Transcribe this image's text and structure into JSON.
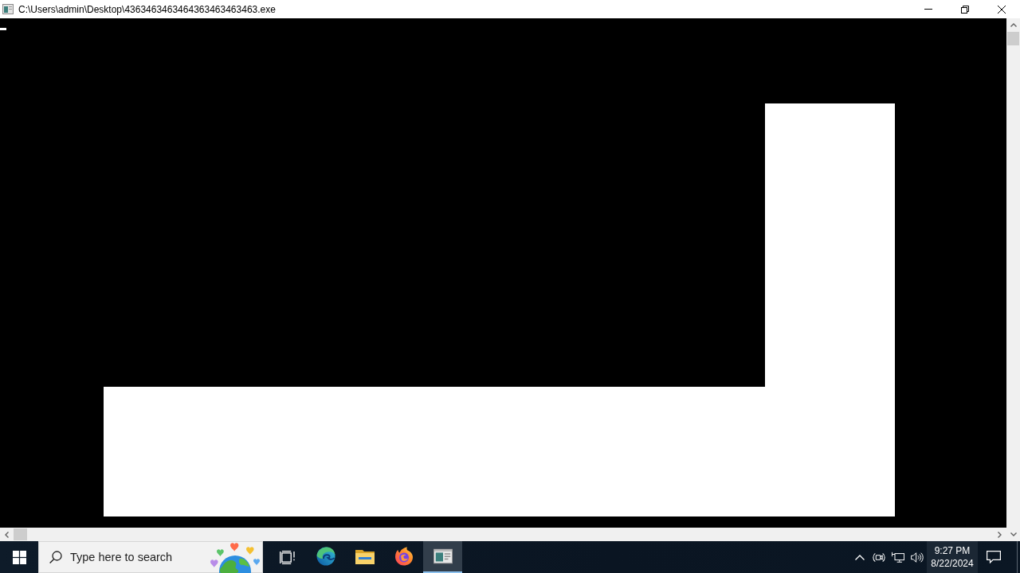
{
  "window": {
    "title": "C:\\Users\\admin\\Desktop\\4363463463464363463463463.exe"
  },
  "taskbar": {
    "search": {
      "placeholder": "Type here to search"
    },
    "apps": [
      {
        "kind": "swirl",
        "selected": false
      },
      {
        "kind": "folder",
        "selected": false
      },
      {
        "kind": "flame",
        "selected": false
      },
      {
        "kind": "console",
        "selected": true
      }
    ],
    "clock": {
      "time": "9:27 PM",
      "date": "8/22/2024"
    }
  }
}
